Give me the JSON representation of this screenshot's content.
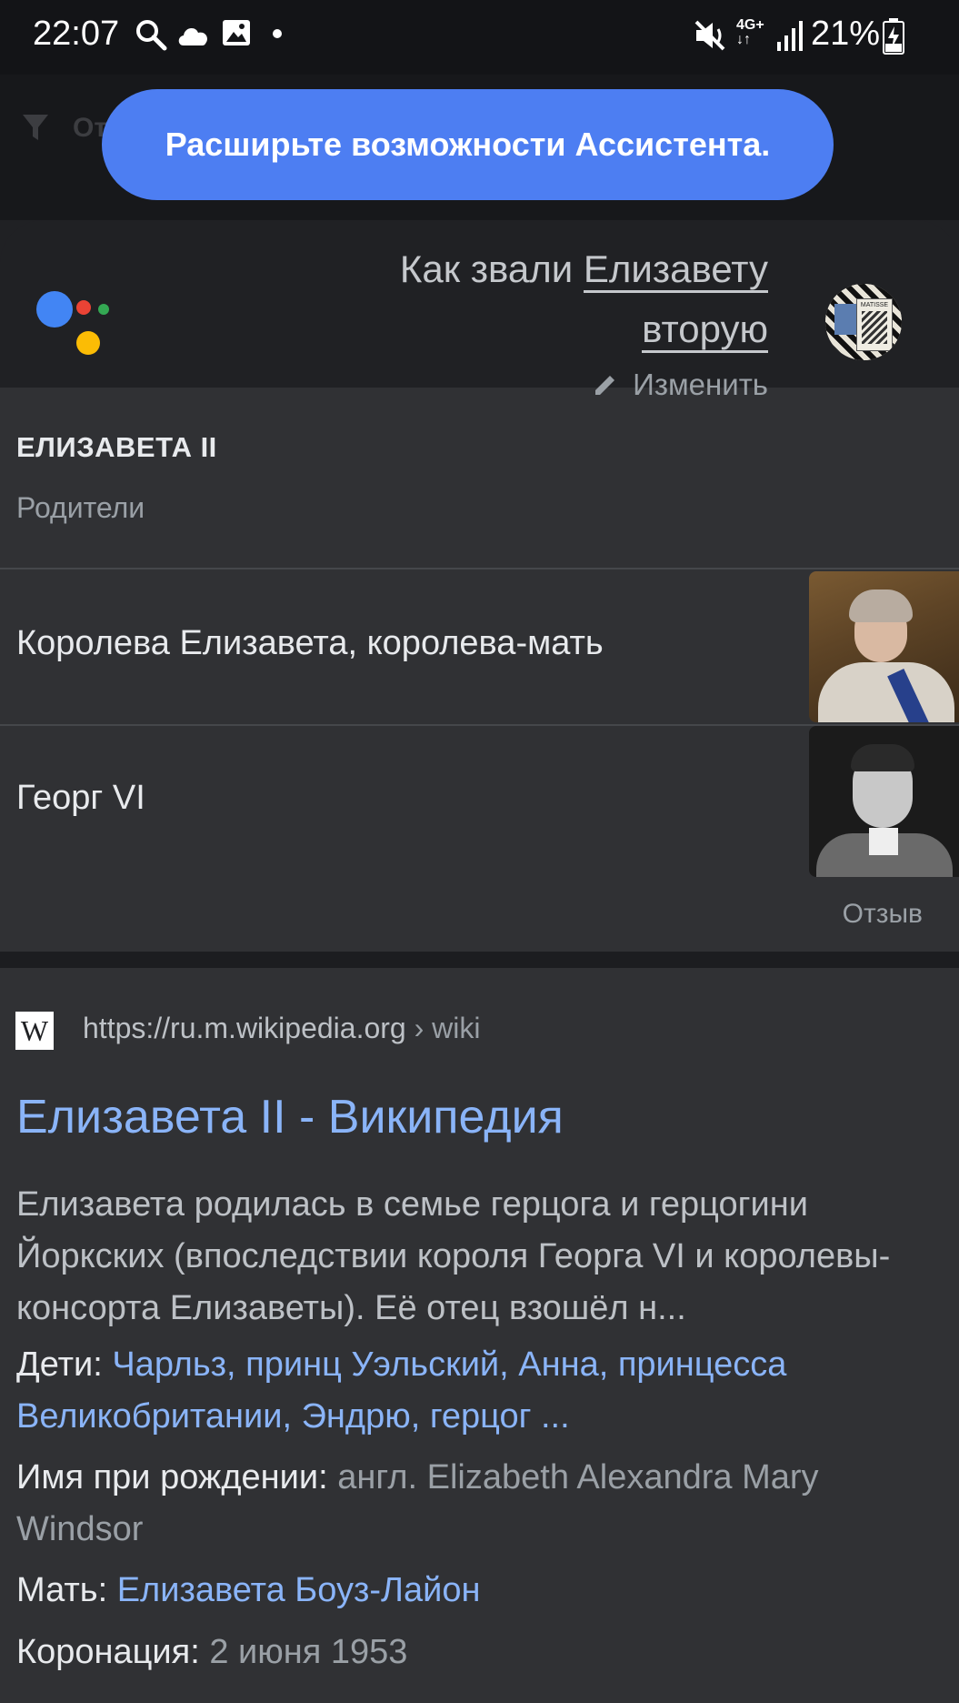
{
  "status_bar": {
    "time": "22:07",
    "battery": "21%",
    "network": "4G+",
    "icons": [
      "search-icon",
      "cloud-icon",
      "image-icon",
      "dot-icon",
      "mute-icon",
      "network-icon",
      "signal-icon",
      "battery-icon"
    ]
  },
  "behind_bar": {
    "filter_label": "От"
  },
  "banner": {
    "text": "Расширьте возможности Ассистента."
  },
  "assistant": {
    "query_line1_prefix": "Как звали ",
    "query_line1_link": "Елизавету",
    "query_line2_link": "вторую",
    "edit_label": "Изменить",
    "avatar_label": "MATISSE",
    "logo_colors": [
      "#4285f4",
      "#ea4335",
      "#fbbc05",
      "#34a853"
    ]
  },
  "knowledge_panel": {
    "title": "ЕЛИЗАВЕТА II",
    "subtitle": "Родители",
    "parents": [
      {
        "name": "Королева Елизавета, королева-мать"
      },
      {
        "name": "Георг VI"
      }
    ],
    "feedback_label": "Отзыв"
  },
  "search_result": {
    "favicon": "W",
    "url_domain": "https://ru.m.wikipedia.org",
    "url_path": " › wiki",
    "title": "Елизавета II - Википедия",
    "snippet": "Елизавета родилась в семье герцога и герцогини Йоркских (впоследствии короля Георга VI и королевы-консорта Елизаветы). Её отец взошёл н...",
    "facts": {
      "children_label": "Дети: ",
      "children_value": "Чарльз, принц Уэльский, Анна, принцесса Великобритании, Эндрю, герцог ...",
      "birth_name_label": "Имя при рождении: ",
      "birth_name_value": "англ. Elizabeth Alexandra Mary Windsor",
      "mother_label": "Мать: ",
      "mother_value": "Елизавета Боуз-Лайон",
      "coronation_label": "Коронация: ",
      "coronation_value": "2 июня 1953"
    }
  }
}
